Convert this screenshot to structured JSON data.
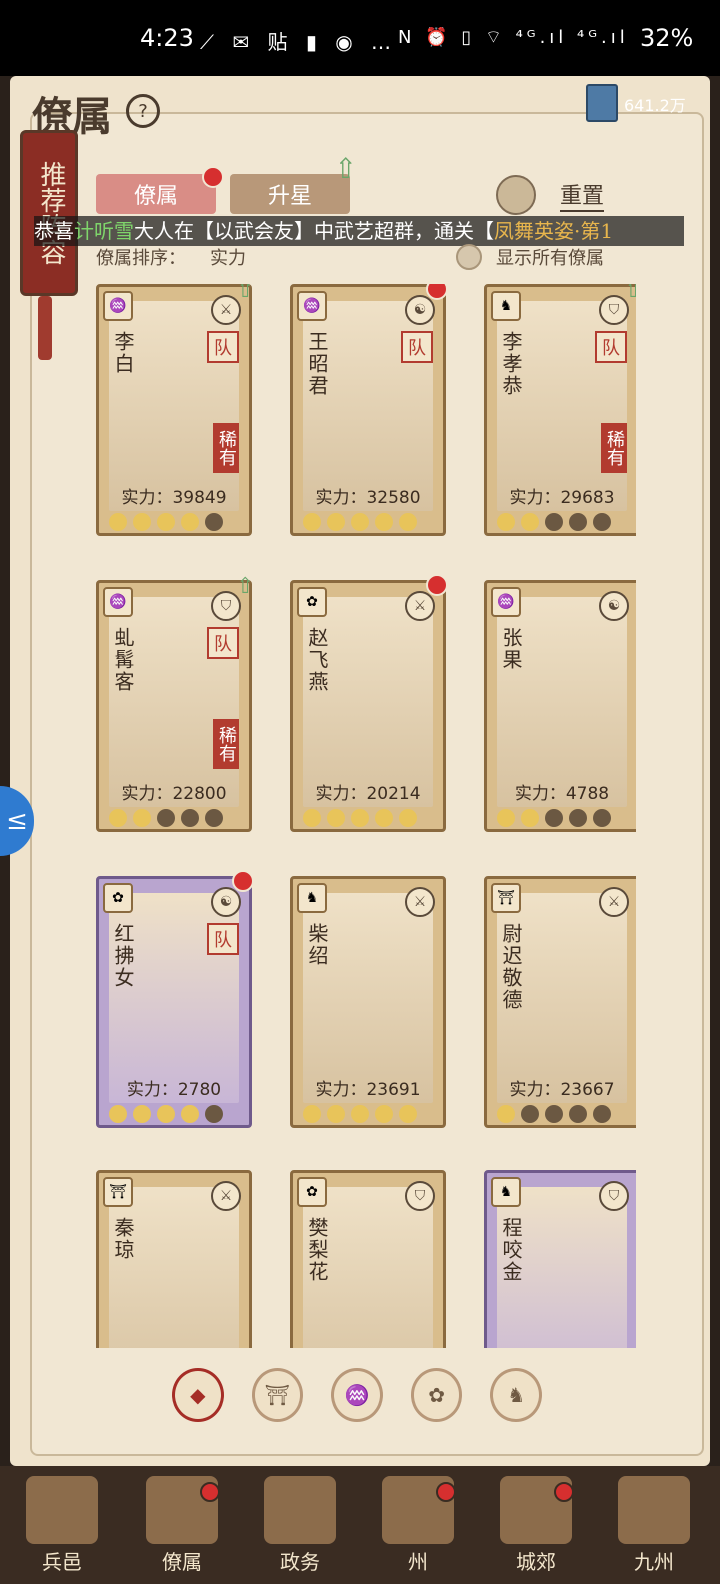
{
  "status_bar": {
    "time": "4:23",
    "icons_left": "⟋ ✉ 贴 ▮ ◉ …",
    "icons_right": "N ⏰ ▯ ⌔ ⁴ᴳ.ıl ⁴ᴳ.ıl",
    "battery": "32%"
  },
  "header": {
    "title": "僚属",
    "help": "?",
    "currency": "641.2万"
  },
  "left_scroll": {
    "label": "推荐阵容"
  },
  "tabs": [
    {
      "label": "僚属"
    },
    {
      "label": "升星"
    }
  ],
  "reset": {
    "label": "重置"
  },
  "ticker": {
    "prefix": "恭喜",
    "name": "计听雪",
    "middle": "大人在【以武会友】中武艺超群，通关【",
    "tail": "凤舞英姿·第1"
  },
  "sort": {
    "label": "僚属排序：",
    "value": "实力"
  },
  "show_all": {
    "label": "显示所有僚属"
  },
  "cards": [
    {
      "name": "李白",
      "power": "实力：39849",
      "team": "队",
      "rare": "稀有",
      "moons_lit": 4,
      "type": "icon-sword",
      "faction": "gourd"
    },
    {
      "name": "王昭君",
      "power": "实力：32580",
      "team": "队",
      "rare": "",
      "moons_lit": 5,
      "type": "icon-taiji",
      "faction": "gourd"
    },
    {
      "name": "李孝恭",
      "power": "实力：29683",
      "team": "队",
      "rare": "稀有",
      "moons_lit": 2,
      "type": "icon-shield",
      "faction": "qilin"
    },
    {
      "name": "虬髯客",
      "power": "实力：22800",
      "team": "队",
      "rare": "稀有",
      "moons_lit": 2,
      "type": "icon-shield",
      "faction": "gourd"
    },
    {
      "name": "赵飞燕",
      "power": "实力：20214",
      "team": "",
      "rare": "",
      "moons_lit": 5,
      "type": "icon-sword",
      "faction": "fan"
    },
    {
      "name": "张果",
      "power": "实力：4788",
      "team": "",
      "rare": "",
      "moons_lit": 2,
      "type": "icon-taiji",
      "faction": "gourd"
    },
    {
      "name": "红拂女",
      "power": "实力：2780",
      "team": "队",
      "rare": "",
      "moons_lit": 4,
      "type": "icon-taiji",
      "faction": "fan"
    },
    {
      "name": "柴绍",
      "power": "实力：23691",
      "team": "",
      "rare": "",
      "moons_lit": 5,
      "type": "icon-sword",
      "faction": "qilin"
    },
    {
      "name": "尉迟敬德",
      "power": "实力：23667",
      "team": "",
      "rare": "",
      "moons_lit": 1,
      "type": "icon-sword",
      "faction": "pagoda"
    },
    {
      "name": "秦琼",
      "power": "",
      "team": "",
      "rare": "",
      "moons_lit": 0,
      "type": "icon-sword",
      "faction": "pagoda"
    },
    {
      "name": "樊梨花",
      "power": "",
      "team": "",
      "rare": "",
      "moons_lit": 0,
      "type": "icon-shield",
      "faction": "fan"
    },
    {
      "name": "程咬金",
      "power": "",
      "team": "",
      "rare": "",
      "moons_lit": 0,
      "type": "icon-shield",
      "faction": "qilin"
    }
  ],
  "filters": [
    "◆",
    "⛩",
    "♒",
    "✿",
    "♞"
  ],
  "bottom_nav": [
    {
      "label": "兵邑"
    },
    {
      "label": "僚属"
    },
    {
      "label": "政务"
    },
    {
      "label": "州"
    },
    {
      "label": "城郊"
    },
    {
      "label": "九州"
    }
  ],
  "side_tab": {
    "icon": "≤"
  }
}
